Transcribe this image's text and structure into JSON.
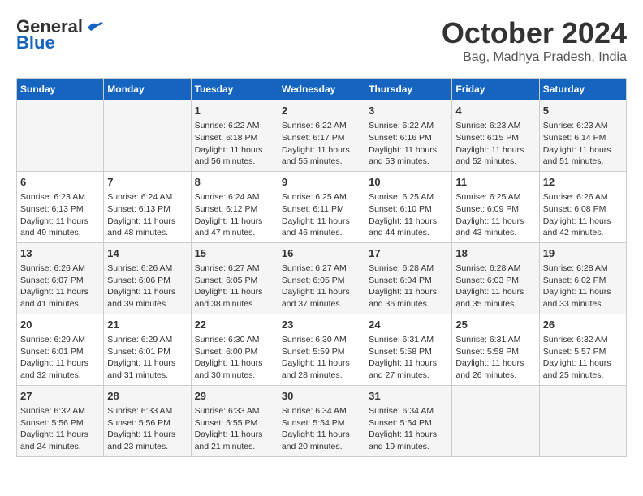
{
  "logo": {
    "text_general": "General",
    "text_blue": "Blue"
  },
  "title": "October 2024",
  "location": "Bag, Madhya Pradesh, India",
  "days_of_week": [
    "Sunday",
    "Monday",
    "Tuesday",
    "Wednesday",
    "Thursday",
    "Friday",
    "Saturday"
  ],
  "weeks": [
    [
      {
        "day": "",
        "info": ""
      },
      {
        "day": "",
        "info": ""
      },
      {
        "day": "1",
        "info": "Sunrise: 6:22 AM\nSunset: 6:18 PM\nDaylight: 11 hours\nand 56 minutes."
      },
      {
        "day": "2",
        "info": "Sunrise: 6:22 AM\nSunset: 6:17 PM\nDaylight: 11 hours\nand 55 minutes."
      },
      {
        "day": "3",
        "info": "Sunrise: 6:22 AM\nSunset: 6:16 PM\nDaylight: 11 hours\nand 53 minutes."
      },
      {
        "day": "4",
        "info": "Sunrise: 6:23 AM\nSunset: 6:15 PM\nDaylight: 11 hours\nand 52 minutes."
      },
      {
        "day": "5",
        "info": "Sunrise: 6:23 AM\nSunset: 6:14 PM\nDaylight: 11 hours\nand 51 minutes."
      }
    ],
    [
      {
        "day": "6",
        "info": "Sunrise: 6:23 AM\nSunset: 6:13 PM\nDaylight: 11 hours\nand 49 minutes."
      },
      {
        "day": "7",
        "info": "Sunrise: 6:24 AM\nSunset: 6:13 PM\nDaylight: 11 hours\nand 48 minutes."
      },
      {
        "day": "8",
        "info": "Sunrise: 6:24 AM\nSunset: 6:12 PM\nDaylight: 11 hours\nand 47 minutes."
      },
      {
        "day": "9",
        "info": "Sunrise: 6:25 AM\nSunset: 6:11 PM\nDaylight: 11 hours\nand 46 minutes."
      },
      {
        "day": "10",
        "info": "Sunrise: 6:25 AM\nSunset: 6:10 PM\nDaylight: 11 hours\nand 44 minutes."
      },
      {
        "day": "11",
        "info": "Sunrise: 6:25 AM\nSunset: 6:09 PM\nDaylight: 11 hours\nand 43 minutes."
      },
      {
        "day": "12",
        "info": "Sunrise: 6:26 AM\nSunset: 6:08 PM\nDaylight: 11 hours\nand 42 minutes."
      }
    ],
    [
      {
        "day": "13",
        "info": "Sunrise: 6:26 AM\nSunset: 6:07 PM\nDaylight: 11 hours\nand 41 minutes."
      },
      {
        "day": "14",
        "info": "Sunrise: 6:26 AM\nSunset: 6:06 PM\nDaylight: 11 hours\nand 39 minutes."
      },
      {
        "day": "15",
        "info": "Sunrise: 6:27 AM\nSunset: 6:05 PM\nDaylight: 11 hours\nand 38 minutes."
      },
      {
        "day": "16",
        "info": "Sunrise: 6:27 AM\nSunset: 6:05 PM\nDaylight: 11 hours\nand 37 minutes."
      },
      {
        "day": "17",
        "info": "Sunrise: 6:28 AM\nSunset: 6:04 PM\nDaylight: 11 hours\nand 36 minutes."
      },
      {
        "day": "18",
        "info": "Sunrise: 6:28 AM\nSunset: 6:03 PM\nDaylight: 11 hours\nand 35 minutes."
      },
      {
        "day": "19",
        "info": "Sunrise: 6:28 AM\nSunset: 6:02 PM\nDaylight: 11 hours\nand 33 minutes."
      }
    ],
    [
      {
        "day": "20",
        "info": "Sunrise: 6:29 AM\nSunset: 6:01 PM\nDaylight: 11 hours\nand 32 minutes."
      },
      {
        "day": "21",
        "info": "Sunrise: 6:29 AM\nSunset: 6:01 PM\nDaylight: 11 hours\nand 31 minutes."
      },
      {
        "day": "22",
        "info": "Sunrise: 6:30 AM\nSunset: 6:00 PM\nDaylight: 11 hours\nand 30 minutes."
      },
      {
        "day": "23",
        "info": "Sunrise: 6:30 AM\nSunset: 5:59 PM\nDaylight: 11 hours\nand 28 minutes."
      },
      {
        "day": "24",
        "info": "Sunrise: 6:31 AM\nSunset: 5:58 PM\nDaylight: 11 hours\nand 27 minutes."
      },
      {
        "day": "25",
        "info": "Sunrise: 6:31 AM\nSunset: 5:58 PM\nDaylight: 11 hours\nand 26 minutes."
      },
      {
        "day": "26",
        "info": "Sunrise: 6:32 AM\nSunset: 5:57 PM\nDaylight: 11 hours\nand 25 minutes."
      }
    ],
    [
      {
        "day": "27",
        "info": "Sunrise: 6:32 AM\nSunset: 5:56 PM\nDaylight: 11 hours\nand 24 minutes."
      },
      {
        "day": "28",
        "info": "Sunrise: 6:33 AM\nSunset: 5:56 PM\nDaylight: 11 hours\nand 23 minutes."
      },
      {
        "day": "29",
        "info": "Sunrise: 6:33 AM\nSunset: 5:55 PM\nDaylight: 11 hours\nand 21 minutes."
      },
      {
        "day": "30",
        "info": "Sunrise: 6:34 AM\nSunset: 5:54 PM\nDaylight: 11 hours\nand 20 minutes."
      },
      {
        "day": "31",
        "info": "Sunrise: 6:34 AM\nSunset: 5:54 PM\nDaylight: 11 hours\nand 19 minutes."
      },
      {
        "day": "",
        "info": ""
      },
      {
        "day": "",
        "info": ""
      }
    ]
  ]
}
